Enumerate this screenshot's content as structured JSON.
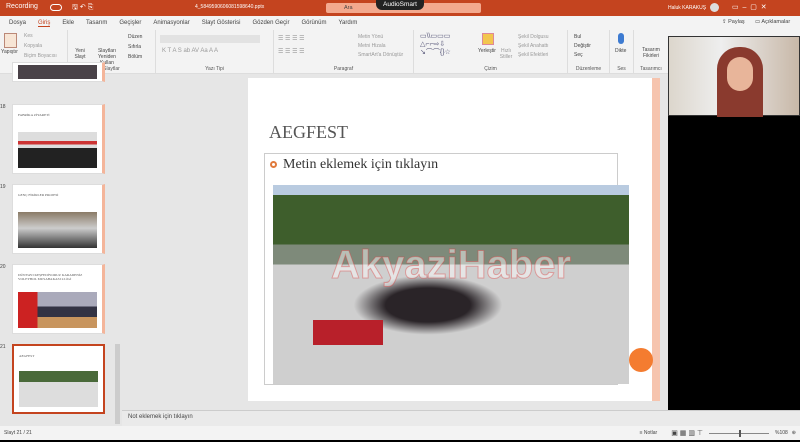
{
  "titlebar": {
    "recording": "Recording",
    "filename": "4_5849590606081598640.pptx",
    "search_placeholder": "Ara",
    "overlay": "AudioSmart",
    "user": "Haluk KARAKUŞ"
  },
  "tabs": [
    "Dosya",
    "Giriş",
    "Ekle",
    "Tasarım",
    "Geçişler",
    "Animasyonlar",
    "Slayt Gösterisi",
    "Gözden Geçir",
    "Görünüm",
    "Yardım"
  ],
  "share": "Paylaş",
  "comments": "Açıklamalar",
  "ribbon": {
    "pano": {
      "label": "Pano",
      "paste": "Yapıştır",
      "cut": "Kes",
      "copy": "Kopyala",
      "format": "Biçim Boyacısı"
    },
    "slaytlar": {
      "label": "Slaytlar",
      "new": "Yeni Slayt",
      "reuse": "Slaytları Yeniden Kullan",
      "layout": "Düzen",
      "reset": "Sıfırla",
      "section": "Bölüm"
    },
    "yazi": {
      "label": "Yazı Tipi"
    },
    "paragraf": {
      "label": "Paragraf",
      "dir": "Metin Yönü",
      "align": "Metni Hizala",
      "smart": "SmartArt'a Dönüştür"
    },
    "cizim": {
      "label": "Çizim",
      "arrange": "Yerleştir",
      "quick": "Hızlı Stiller",
      "fill": "Şekil Dolgusu",
      "outline": "Şekil Anahattı",
      "effects": "Şekil Efektleri"
    },
    "duzenleme": {
      "label": "Düzenleme",
      "find": "Bul",
      "replace": "Değiştir",
      "select": "Seç"
    },
    "ses": {
      "label": "Ses",
      "dictate": "Dikte"
    },
    "tasarimci": {
      "label": "Tasarımcı",
      "ideas": "Tasarım Fikirleri"
    }
  },
  "thumbnails": [
    {
      "num": "18",
      "title": "FABRİKA ZİYARETİ"
    },
    {
      "num": "19",
      "title": "GENÇ FİKİRLER PROJESİ"
    },
    {
      "num": "20",
      "title": "DÜNYAYI KEŞFEDİYORUZ KARADENİZ VOLEYBOL MUSABAKASI 2.LİGİ"
    },
    {
      "num": "21",
      "title": "AEGFEST"
    }
  ],
  "slide": {
    "title": "AEGFEST",
    "bullet": "Metin eklemek için tıklayın",
    "watermark": "AkyaziHaber"
  },
  "notes": "Not eklemek için tıklayın",
  "status": {
    "slide": "Slayt 21 / 21",
    "notes": "Notlar",
    "zoom": "%108"
  },
  "colors": {
    "accent": "#c4441f",
    "slide_accent": "#f6c4ae",
    "bullet": "#e07a3c"
  }
}
